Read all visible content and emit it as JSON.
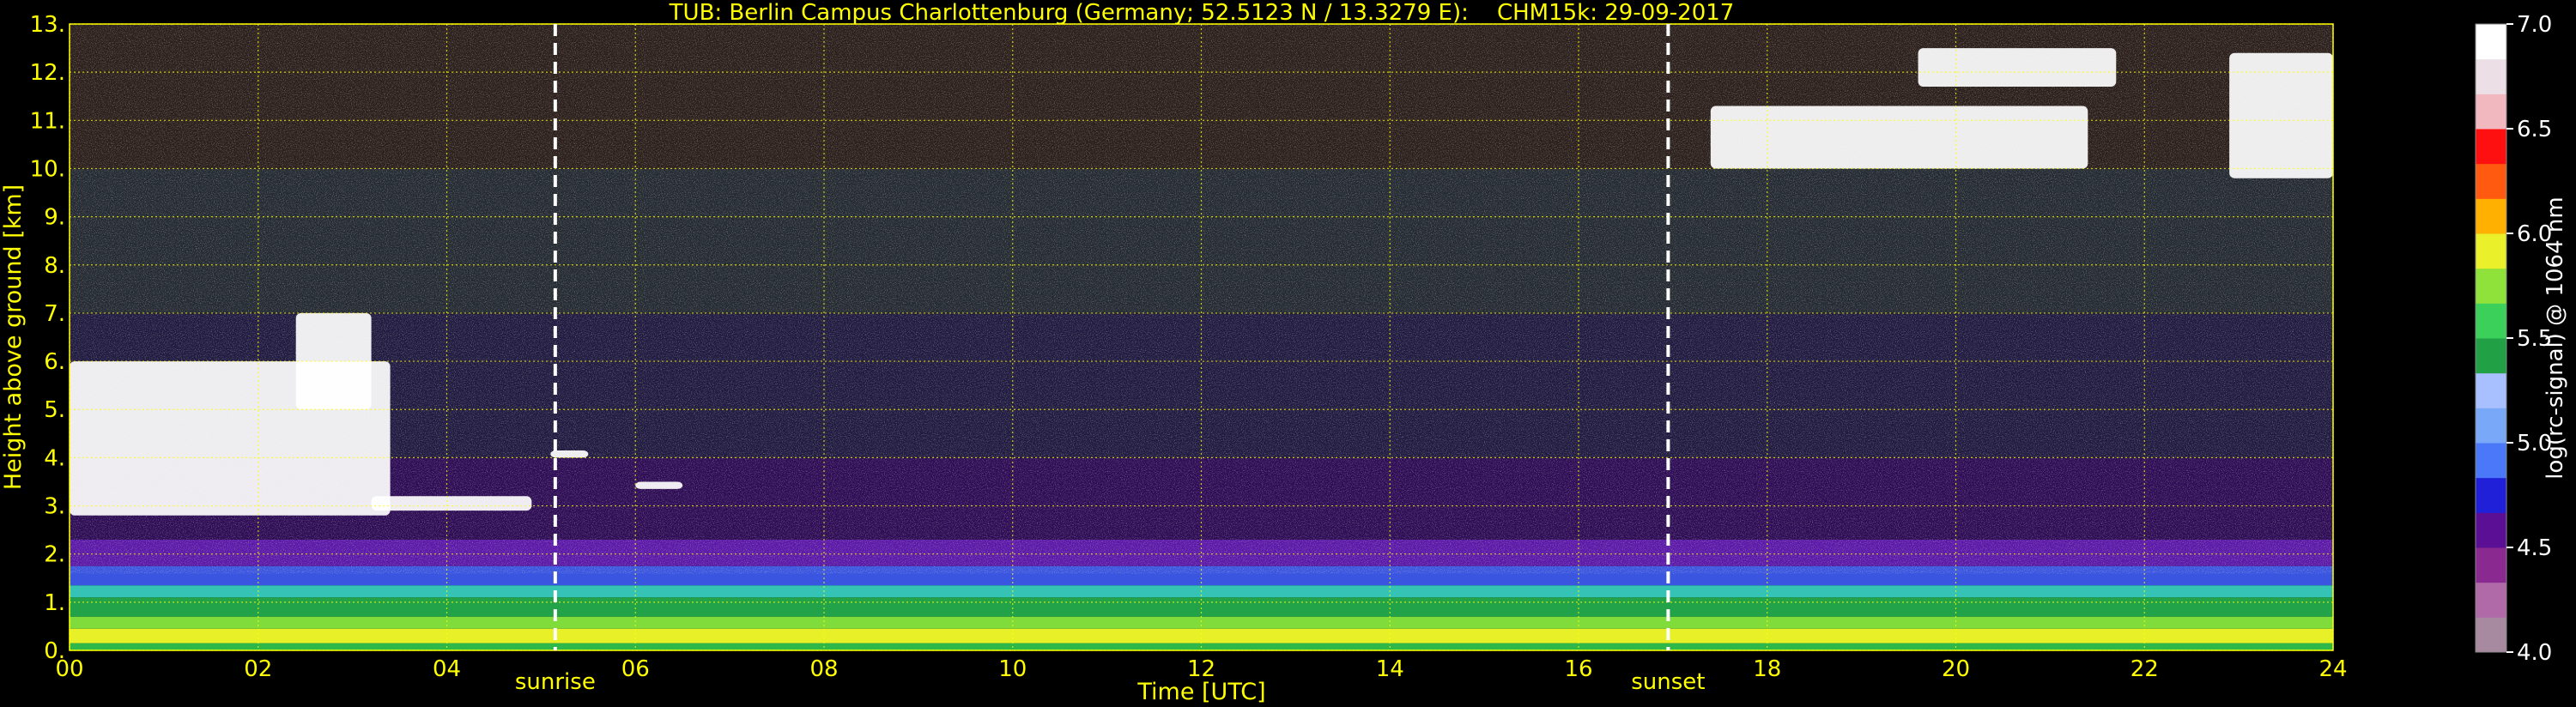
{
  "chart_data": {
    "type": "heatmap",
    "title": "TUB: Berlin Campus Charlottenburg (Germany; 52.5123 N / 13.3279 E):    CHM15k: 29-09-2017",
    "xlabel": "Time [UTC]",
    "ylabel": "Height above ground [km]",
    "xlim": [
      0,
      24
    ],
    "ylim": [
      0,
      13
    ],
    "x_ticks": [
      "00",
      "02",
      "04",
      "06",
      "08",
      "10",
      "12",
      "14",
      "16",
      "18",
      "20",
      "22",
      "24"
    ],
    "y_ticks": [
      "0.",
      "1.",
      "2.",
      "3.",
      "4.",
      "5.",
      "6.",
      "7.",
      "8.",
      "9.",
      "10.",
      "11.",
      "12.",
      "13."
    ],
    "grid": true,
    "grid_color": "#ffff00",
    "text_color": "#ffff00",
    "annotations": [
      {
        "label": "sunrise",
        "x": 5.15
      },
      {
        "label": "sunset",
        "x": 16.95
      }
    ],
    "layers": [
      {
        "h0": 0.0,
        "h1": 0.15,
        "color": "#2fb84a"
      },
      {
        "h0": 0.15,
        "h1": 0.45,
        "color": "#e8f028"
      },
      {
        "h0": 0.45,
        "h1": 0.7,
        "color": "#7fdc3a"
      },
      {
        "h0": 0.7,
        "h1": 1.1,
        "color": "#22a34a"
      },
      {
        "h0": 1.1,
        "h1": 1.35,
        "color": "#34c3b4"
      },
      {
        "h0": 1.35,
        "h1": 1.75,
        "color": "#3a55e0"
      },
      {
        "h0": 1.75,
        "h1": 2.3,
        "color": "#5a18a8"
      },
      {
        "h0": 2.3,
        "h1": 4.0,
        "color": "#2c0c55"
      },
      {
        "h0": 4.0,
        "h1": 7.0,
        "color": "#1f1a40"
      },
      {
        "h0": 7.0,
        "h1": 10.0,
        "color": "#232a32"
      },
      {
        "h0": 10.0,
        "h1": 13.0,
        "color": "#2a1f1c"
      }
    ],
    "clouds": [
      {
        "t": [
          0.0,
          3.4
        ],
        "h": [
          2.8,
          6.0
        ],
        "color": "#ffffff"
      },
      {
        "t": [
          2.4,
          3.2
        ],
        "h": [
          5.0,
          7.0
        ],
        "color": "#ffffff"
      },
      {
        "t": [
          3.2,
          4.9
        ],
        "h": [
          2.9,
          3.2
        ],
        "color": "#ffffff"
      },
      {
        "t": [
          5.1,
          5.5
        ],
        "h": [
          4.0,
          4.15
        ],
        "color": "#ffffff"
      },
      {
        "t": [
          6.0,
          6.5
        ],
        "h": [
          3.35,
          3.5
        ],
        "color": "#ffffff"
      },
      {
        "t": [
          17.4,
          21.4
        ],
        "h": [
          10.0,
          11.3
        ],
        "color": "#ffffff"
      },
      {
        "t": [
          19.6,
          21.7
        ],
        "h": [
          11.7,
          12.5
        ],
        "color": "#ffffff"
      },
      {
        "t": [
          22.9,
          24.0
        ],
        "h": [
          9.8,
          12.4
        ],
        "color": "#ffffff"
      }
    ],
    "colorbar": {
      "label": "log(rc-signal) @ 1064 nm",
      "range": [
        4.0,
        7.0
      ],
      "ticks": [
        "4.0",
        "4.5",
        "5.0",
        "5.5",
        "6.0",
        "6.5",
        "7.0"
      ],
      "colors": [
        "#a88aa0",
        "#b06aa8",
        "#8a2a90",
        "#5a0f95",
        "#2020d8",
        "#4a78f8",
        "#7aa8f8",
        "#a8c0ff",
        "#22a045",
        "#3ad05a",
        "#8ee23a",
        "#eaf02a",
        "#ffb000",
        "#ff5a10",
        "#ff1010",
        "#f2b8c0",
        "#ece0e6",
        "#ffffff"
      ]
    }
  }
}
